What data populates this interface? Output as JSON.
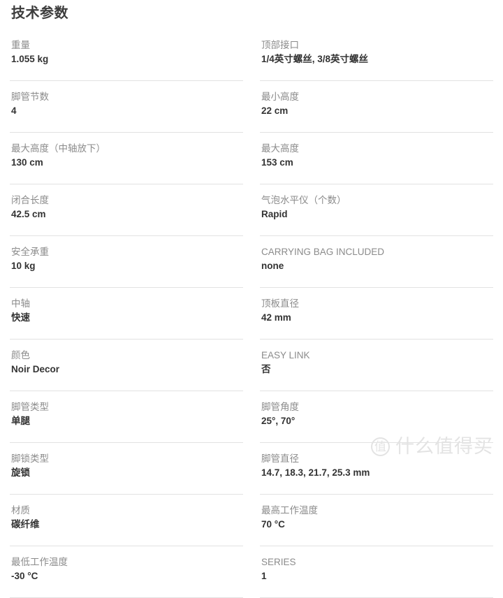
{
  "panel": {
    "title": "技术参数",
    "columns": [
      {
        "name": "left-column",
        "rows": [
          {
            "label": "重量",
            "value": "1.055 kg"
          },
          {
            "label": "脚管节数",
            "value": "4"
          },
          {
            "label": "最大高度（中轴放下）",
            "value": "130 cm"
          },
          {
            "label": "闭合长度",
            "value": "42.5 cm"
          },
          {
            "label": "安全承重",
            "value": "10 kg"
          },
          {
            "label": "中轴",
            "value": "快速"
          },
          {
            "label": "颜色",
            "value": "Noir Decor"
          },
          {
            "label": "脚管类型",
            "value": "单腿"
          },
          {
            "label": "脚锁类型",
            "value": "旋锁"
          },
          {
            "label": "材质",
            "value": "碳纤维"
          },
          {
            "label": "最低工作温度",
            "value": "-30 °C"
          }
        ]
      },
      {
        "name": "right-column",
        "rows": [
          {
            "label": "顶部接口",
            "value": "1/4英寸螺丝, 3/8英寸螺丝"
          },
          {
            "label": "最小高度",
            "value": "22 cm"
          },
          {
            "label": "最大高度",
            "value": "153 cm"
          },
          {
            "label": "气泡水平仪（个数）",
            "value": "Rapid"
          },
          {
            "label": "CARRYING BAG INCLUDED",
            "value": "none"
          },
          {
            "label": "顶板直径",
            "value": "42 mm"
          },
          {
            "label": "EASY LINK",
            "value": "否"
          },
          {
            "label": "脚管角度",
            "value": "25°, 70°"
          },
          {
            "label": "脚管直径",
            "value": "14.7, 18.3, 21.7, 25.3 mm"
          },
          {
            "label": "最高工作温度",
            "value": "70 °C"
          },
          {
            "label": "SERIES",
            "value": "1"
          }
        ]
      }
    ]
  },
  "watermark": {
    "mark": "值",
    "text": "什么值得买"
  },
  "colors": {
    "background": "#ffffff",
    "title": "#3c3c3c",
    "label": "#8b8b8b",
    "value": "#333333",
    "divider": "#e2e2e2",
    "watermark": "#e3e3e3"
  }
}
